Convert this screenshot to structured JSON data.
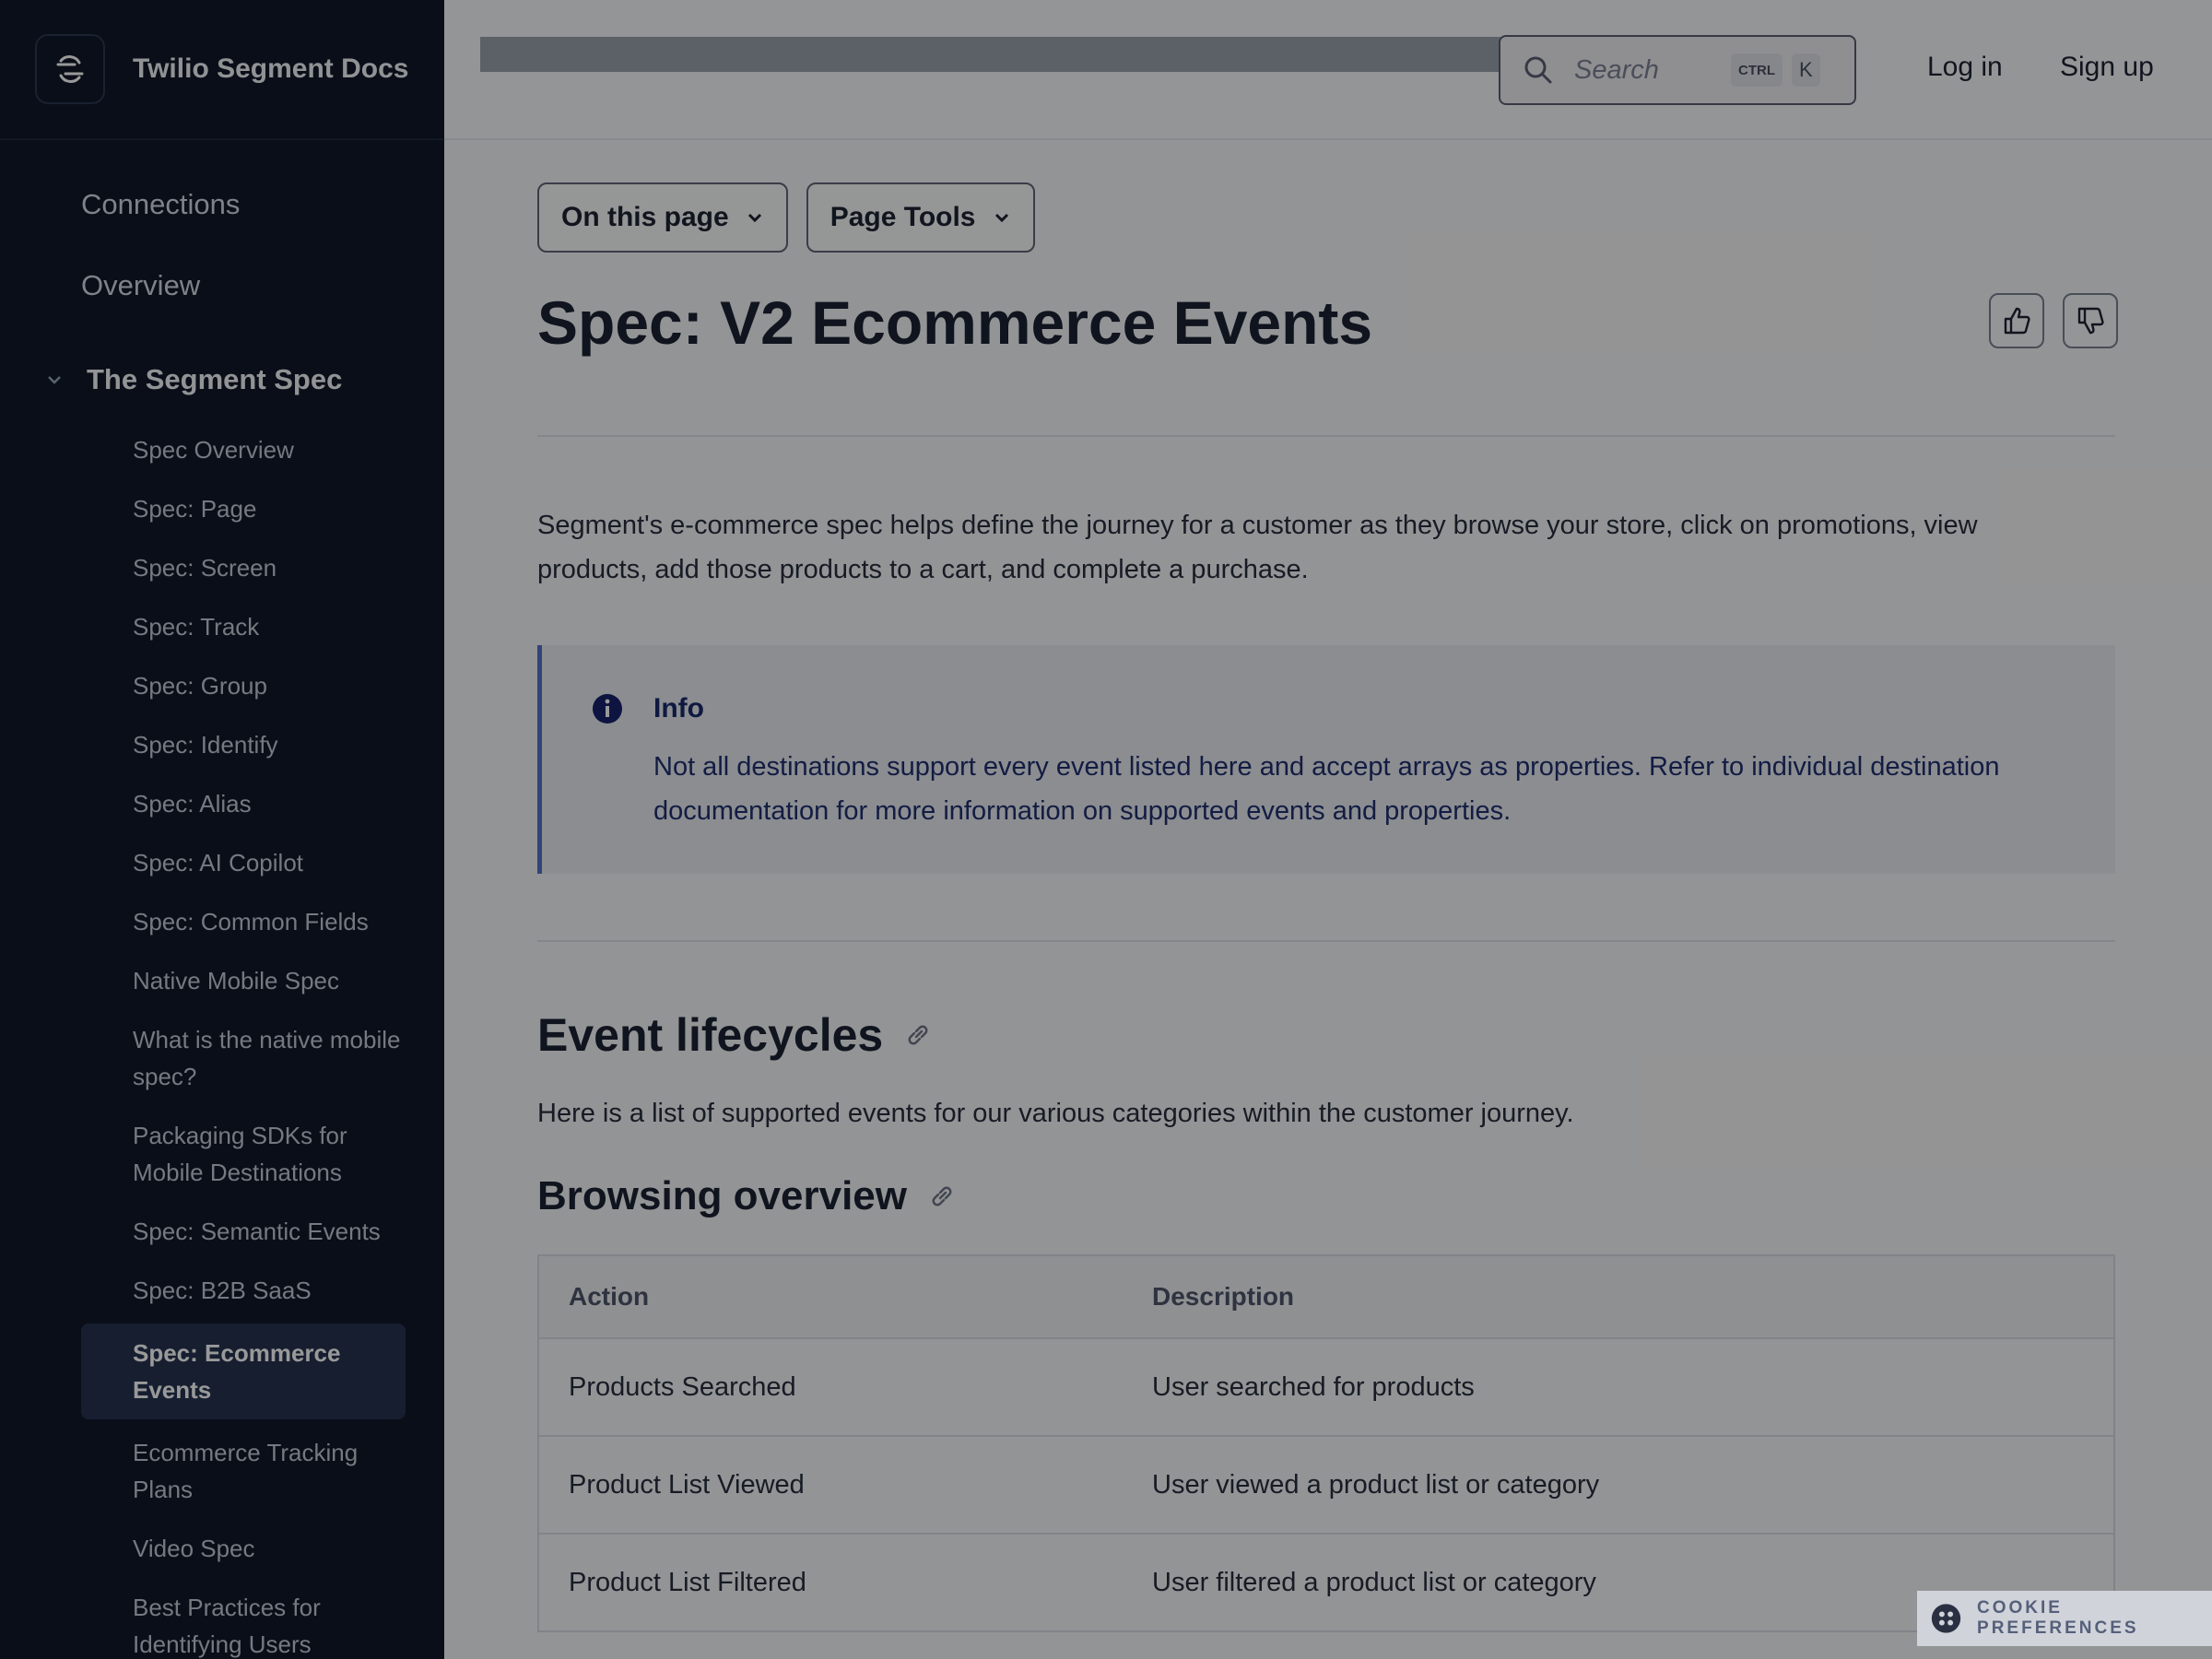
{
  "brand": {
    "title": "Twilio Segment Docs"
  },
  "topbar": {
    "search_placeholder": "Search",
    "kbd_ctrl": "CTRL",
    "kbd_k": "K",
    "login": "Log in",
    "signup": "Sign up"
  },
  "sidebar": {
    "top_items": [
      "Connections",
      "Overview"
    ],
    "section": "The Segment Spec",
    "items": [
      "Spec Overview",
      "Spec: Page",
      "Spec: Screen",
      "Spec: Track",
      "Spec: Group",
      "Spec: Identify",
      "Spec: Alias",
      "Spec: AI Copilot",
      "Spec: Common Fields",
      "Native Mobile Spec",
      "What is the native mobile spec?",
      "Packaging SDKs for Mobile Destinations",
      "Spec: Semantic Events",
      "Spec: B2B SaaS",
      "Spec: Ecommerce Events",
      "Ecommerce Tracking Plans",
      "Video Spec",
      "Best Practices for Identifying Users"
    ],
    "active_item": "Spec: Ecommerce Events"
  },
  "toolbar": {
    "on_this_page": "On this page",
    "page_tools": "Page Tools"
  },
  "page": {
    "title": "Spec: V2 Ecommerce Events",
    "intro": "Segment's e-commerce spec helps define the journey for a customer as they browse your store, click on promotions, view products, add those products to a cart, and complete a purchase.",
    "callout_title": "Info",
    "callout_body": "Not all destinations support every event listed here and accept arrays as properties. Refer to individual destination documentation for more information on supported events and properties.",
    "h2": "Event lifecycles",
    "h2_text": "Here is a list of supported events for our various categories within the customer journey.",
    "h3": "Browsing overview"
  },
  "table": {
    "headers": [
      "Action",
      "Description"
    ],
    "rows": [
      [
        "Products Searched",
        "User searched for products"
      ],
      [
        "Product List Viewed",
        "User viewed a product list or category"
      ],
      [
        "Product List Filtered",
        "User filtered a product list or category"
      ]
    ]
  },
  "cookie": {
    "label": "COOKIE PREFERENCES"
  }
}
